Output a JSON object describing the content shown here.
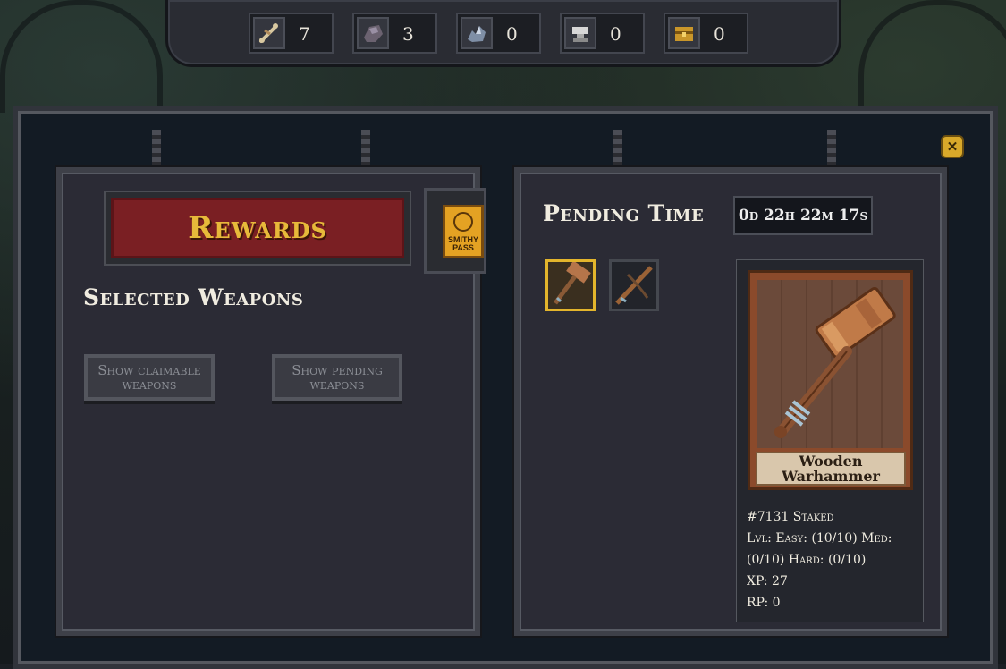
{
  "resources": [
    {
      "icon": "bone-icon",
      "count": "7"
    },
    {
      "icon": "ore-icon",
      "count": "3"
    },
    {
      "icon": "crystal-icon",
      "count": "0"
    },
    {
      "icon": "anvil-icon",
      "count": "0"
    },
    {
      "icon": "chest-icon",
      "count": "0"
    }
  ],
  "left_panel": {
    "title": "Rewards",
    "smithy_pass_label": "SMITHY PASS",
    "selected_heading": "Selected Weapons",
    "show_claimable_label": "Show claimable weapons",
    "show_pending_label": "Show pending weapons"
  },
  "right_panel": {
    "pending_heading": "Pending Time",
    "pending_time": "0d 22h 22m 17s",
    "weapon_name": "Wooden Warhammer",
    "stats": {
      "id_line": "#7131 Staked",
      "level_line_1": "Lvl: Easy: (10/10) Med:",
      "level_line_2": "(0/10) Hard: (0/10)",
      "xp": "XP: 27",
      "rp": "RP: 0"
    }
  },
  "colors": {
    "accent_gold": "#e3b52c",
    "banner_red": "#7a1f23",
    "panel_bg": "#2b2b35"
  }
}
